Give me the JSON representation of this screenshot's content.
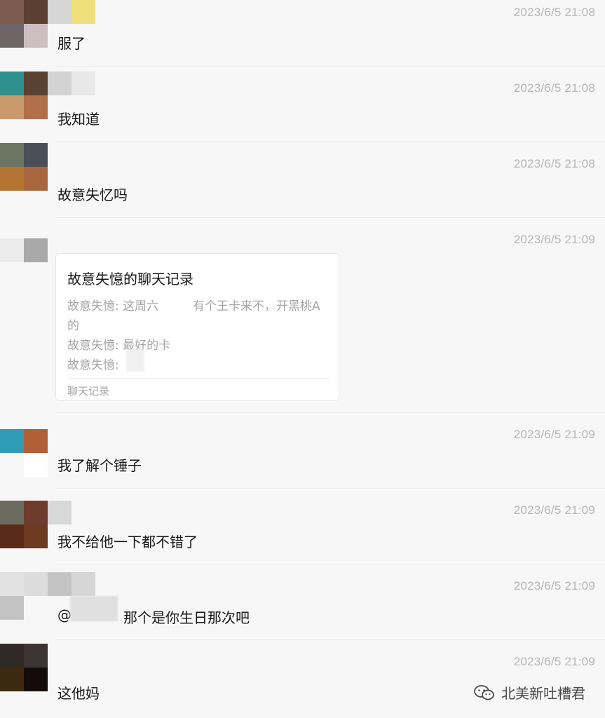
{
  "messages": [
    {
      "id": "m1",
      "time": "2023/6/5 21:08",
      "text": "服了",
      "avatar_colors": [
        "#7d5a50",
        "#5b4032",
        "#6e6666",
        "#cdbebf"
      ],
      "redact_colors": [
        "#d6d6d6",
        "#eedf7a",
        "#ffffff",
        "#ffffff"
      ]
    },
    {
      "id": "m2",
      "time": "2023/6/5 21:08",
      "text": "我知道",
      "avatar_colors": [
        "#2f8f8d",
        "#5a4233",
        "#c89a6c",
        "#b0704a"
      ],
      "redact_colors": [
        "#d3d3d3",
        "#e8e8e8",
        "#f7f7f7",
        "#f7f7f7"
      ]
    },
    {
      "id": "m3",
      "time": "2023/6/5 21:08",
      "text": "故意失忆吗",
      "avatar_colors": [
        "#6c7763",
        "#4a4f57",
        "#b57532",
        "#a8673e"
      ],
      "redact_colors": []
    },
    {
      "id": "m4",
      "time": "2023/6/5 21:09",
      "text": "",
      "avatar_colors": [
        "#ececec",
        "#a9a9a9",
        "#f7f7f7",
        "#f7f7f7"
      ],
      "redact_colors": []
    },
    {
      "id": "m5",
      "time": "2023/6/5 21:09",
      "text": "我了解个锤子",
      "avatar_colors": [
        "#2f9bb4",
        "#b15f37",
        "#f7f7f7",
        "#ffffff"
      ],
      "redact_colors": []
    },
    {
      "id": "m6",
      "time": "2023/6/5 21:09",
      "text": "我不给他一下都不错了",
      "avatar_colors": [
        "#6c6b60",
        "#6e3c2c",
        "#5a2b18",
        "#6d3a22"
      ],
      "redact_colors": [
        "#d8d8d8",
        "#f7f7f7",
        "#f7f7f7",
        "#f7f7f7"
      ]
    },
    {
      "id": "m7",
      "time": "2023/6/5 21:09",
      "text_prefix": "@",
      "text": "那个是你生日那次吧",
      "avatar_colors": [
        "#e2e2e2",
        "#dcdcdc",
        "#c3c3c3",
        "#f7f7f7"
      ],
      "redact_colors": [
        "#c4c4c4",
        "#d6d6d6",
        "#f7f7f7",
        "#f7f7f7"
      ]
    },
    {
      "id": "m8",
      "time": "2023/6/5 21:09",
      "text": "这他妈",
      "avatar_colors": [
        "#2f2a27",
        "#3d3434",
        "#3c2910",
        "#140c0a"
      ],
      "redact_colors": [
        "#f2f2f2",
        "#f7f7f7",
        "#f7f7f7",
        "#f7f7f7"
      ]
    }
  ],
  "chat_record_card": {
    "title": "故意失憶的聊天记录",
    "lines": [
      "故意失憶: 这周六",
      "有个王卡来不，开黑桃A",
      "的",
      "故意失憶: 最好的卡",
      "故意失憶:"
    ],
    "footer": "聊天记录"
  },
  "watermark": {
    "text": "北美新吐槽君",
    "icon": "wechat-icon"
  }
}
